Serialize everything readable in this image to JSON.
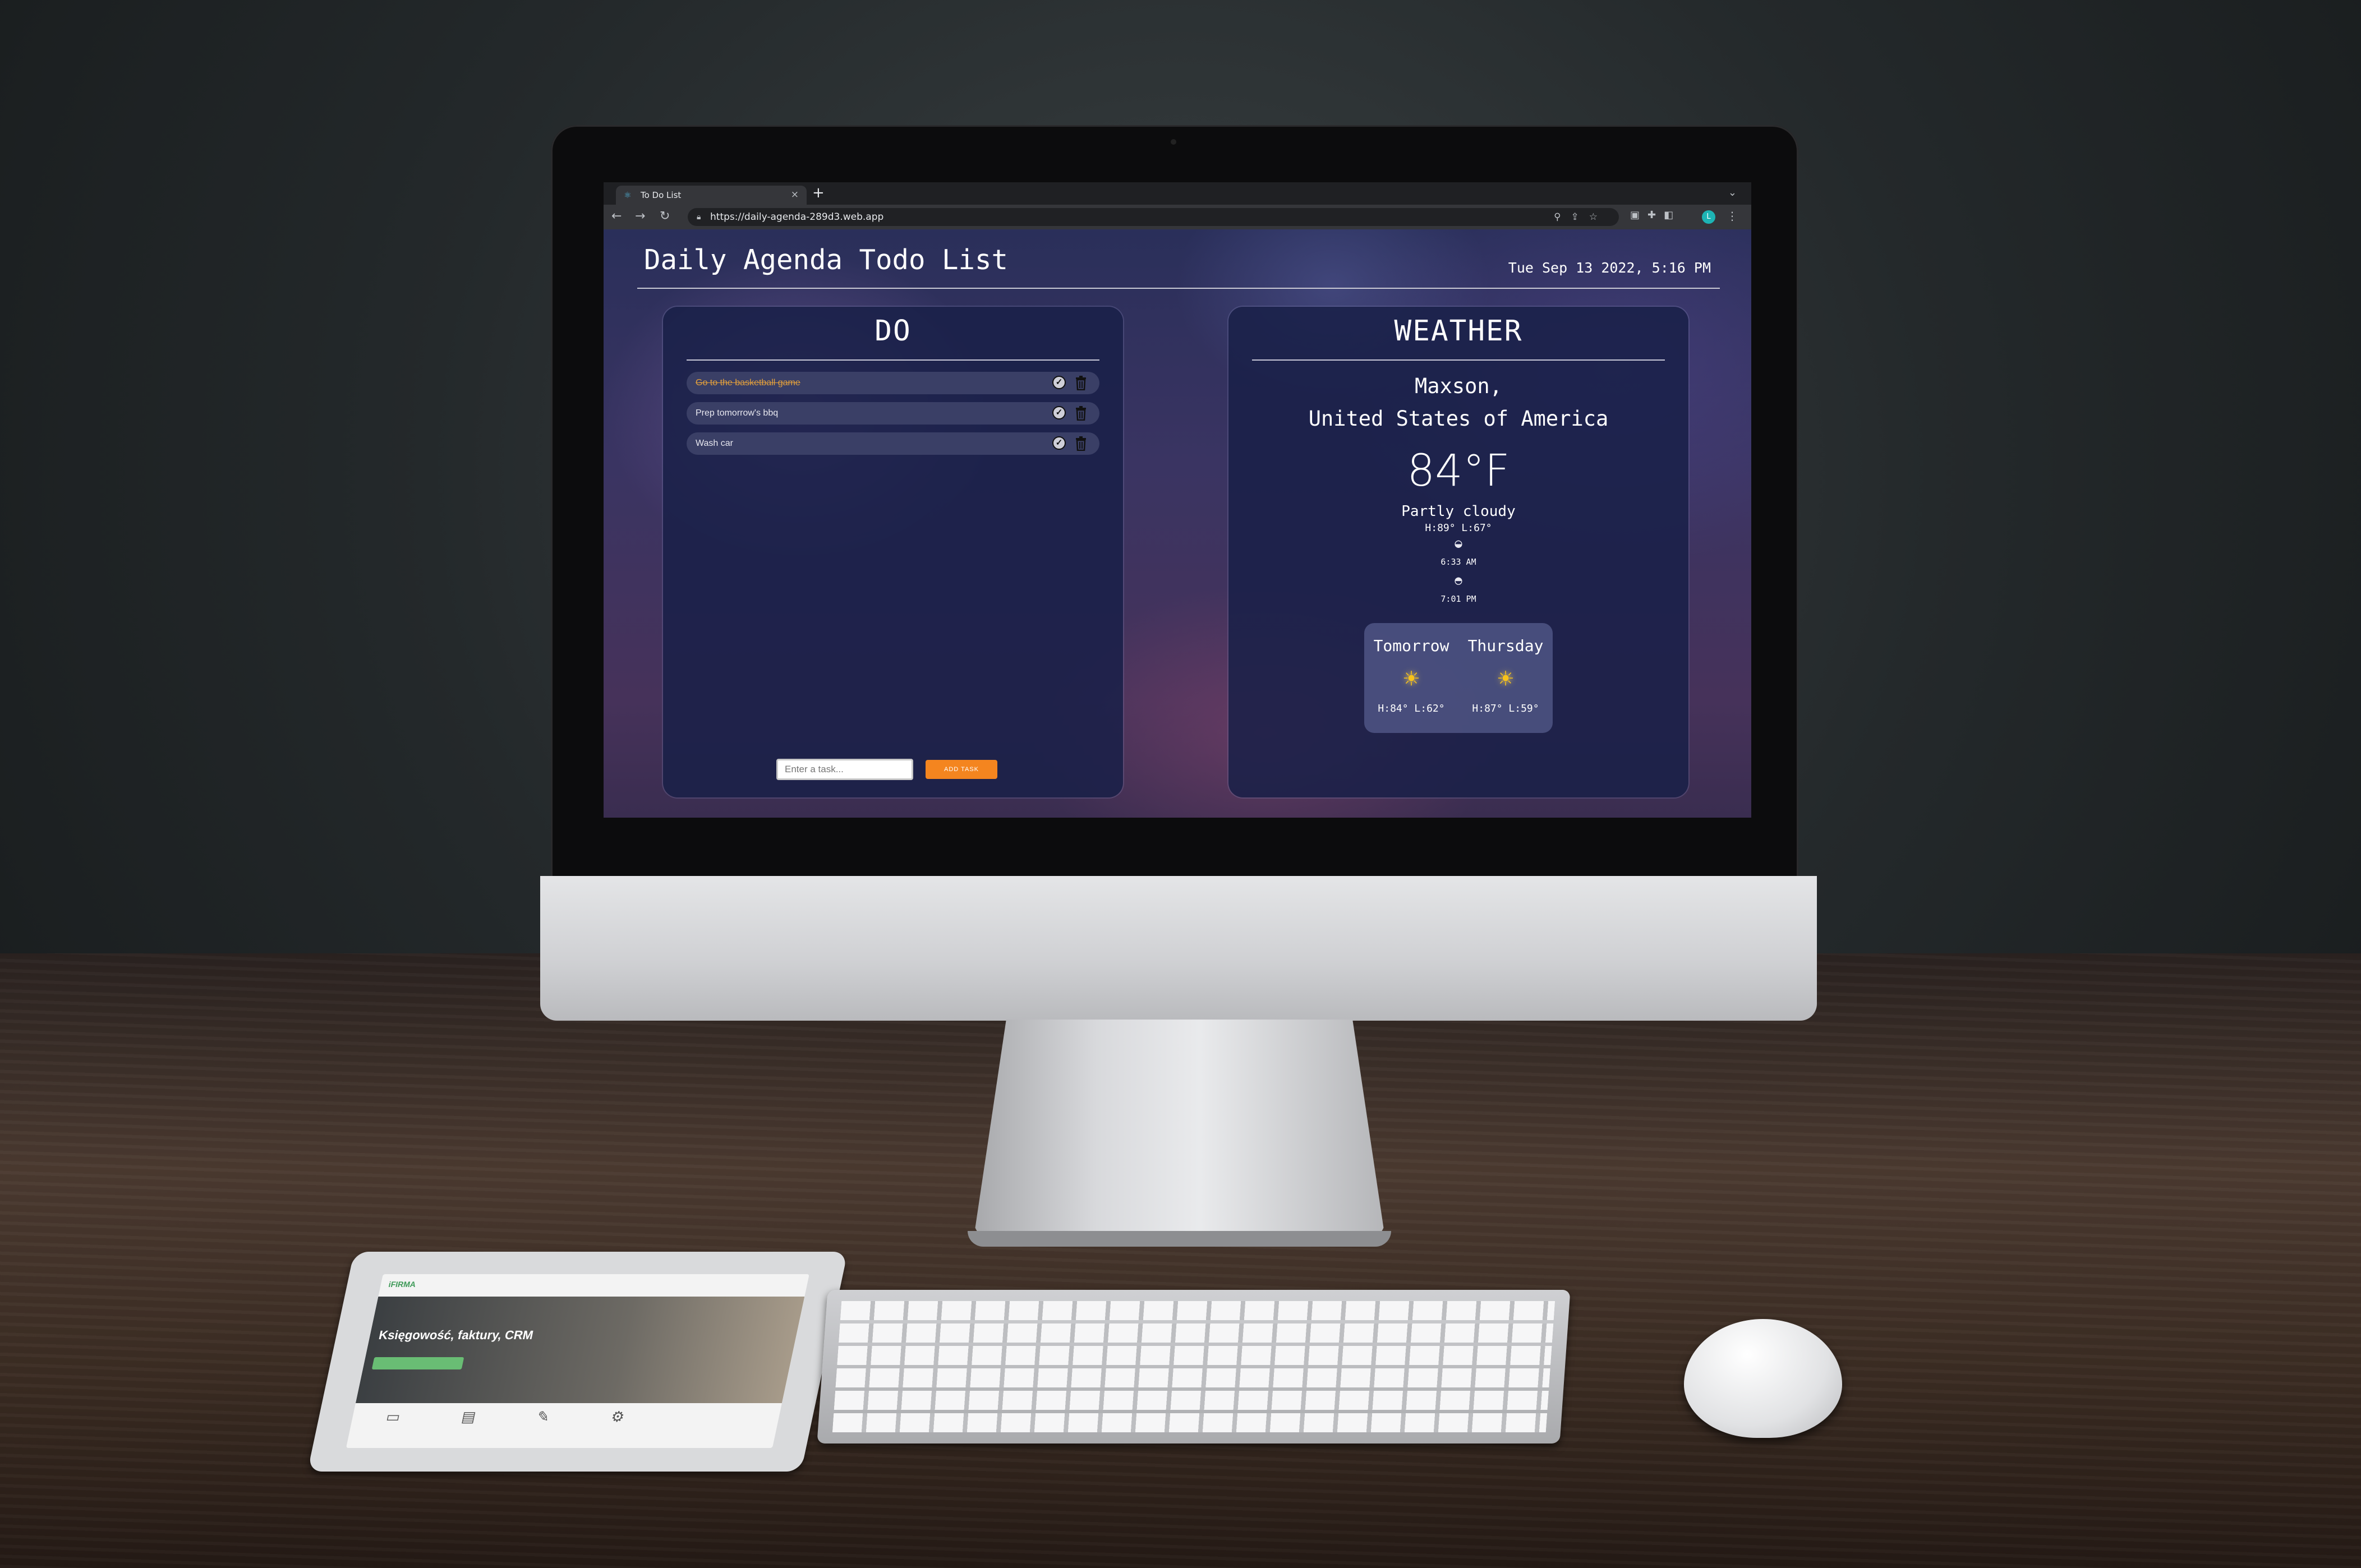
{
  "browser": {
    "tab_title": "To Do List",
    "tab_favicon": "react-icon",
    "new_tab": "+",
    "url": "https://daily-agenda-289d3.web.app",
    "profile_initial": "L"
  },
  "app": {
    "title": "Daily Agenda Todo List",
    "datetime": "Tue Sep 13 2022, 5:16 PM"
  },
  "todo": {
    "heading": "DO",
    "tasks": [
      {
        "text": "Go to the basketball game",
        "completed": true
      },
      {
        "text": "Prep tomorrow's bbq",
        "completed": false
      },
      {
        "text": "Wash car",
        "completed": false
      }
    ],
    "input_placeholder": "Enter a task...",
    "add_button": "ADD TASK"
  },
  "weather": {
    "heading": "WEATHER",
    "city": "Maxson,",
    "country": "United States of America",
    "temperature": "84°F",
    "condition": "Partly cloudy",
    "high_low": "H:89° L:67°",
    "sunrise": "6:33 AM",
    "sunset": "7:01 PM",
    "forecast": [
      {
        "day": "Tomorrow",
        "icon": "sun-icon",
        "high_low": "H:84° L:62°"
      },
      {
        "day": "Thursday",
        "icon": "sun-icon",
        "high_low": "H:87° L:59°"
      }
    ]
  },
  "tablet": {
    "logo": "iFIRMA",
    "headline": "Księgowość, faktury, CRM"
  },
  "colors": {
    "accent_orange": "#f4851f",
    "completed_task": "#e3a03c",
    "panel_bg": "#192048"
  }
}
